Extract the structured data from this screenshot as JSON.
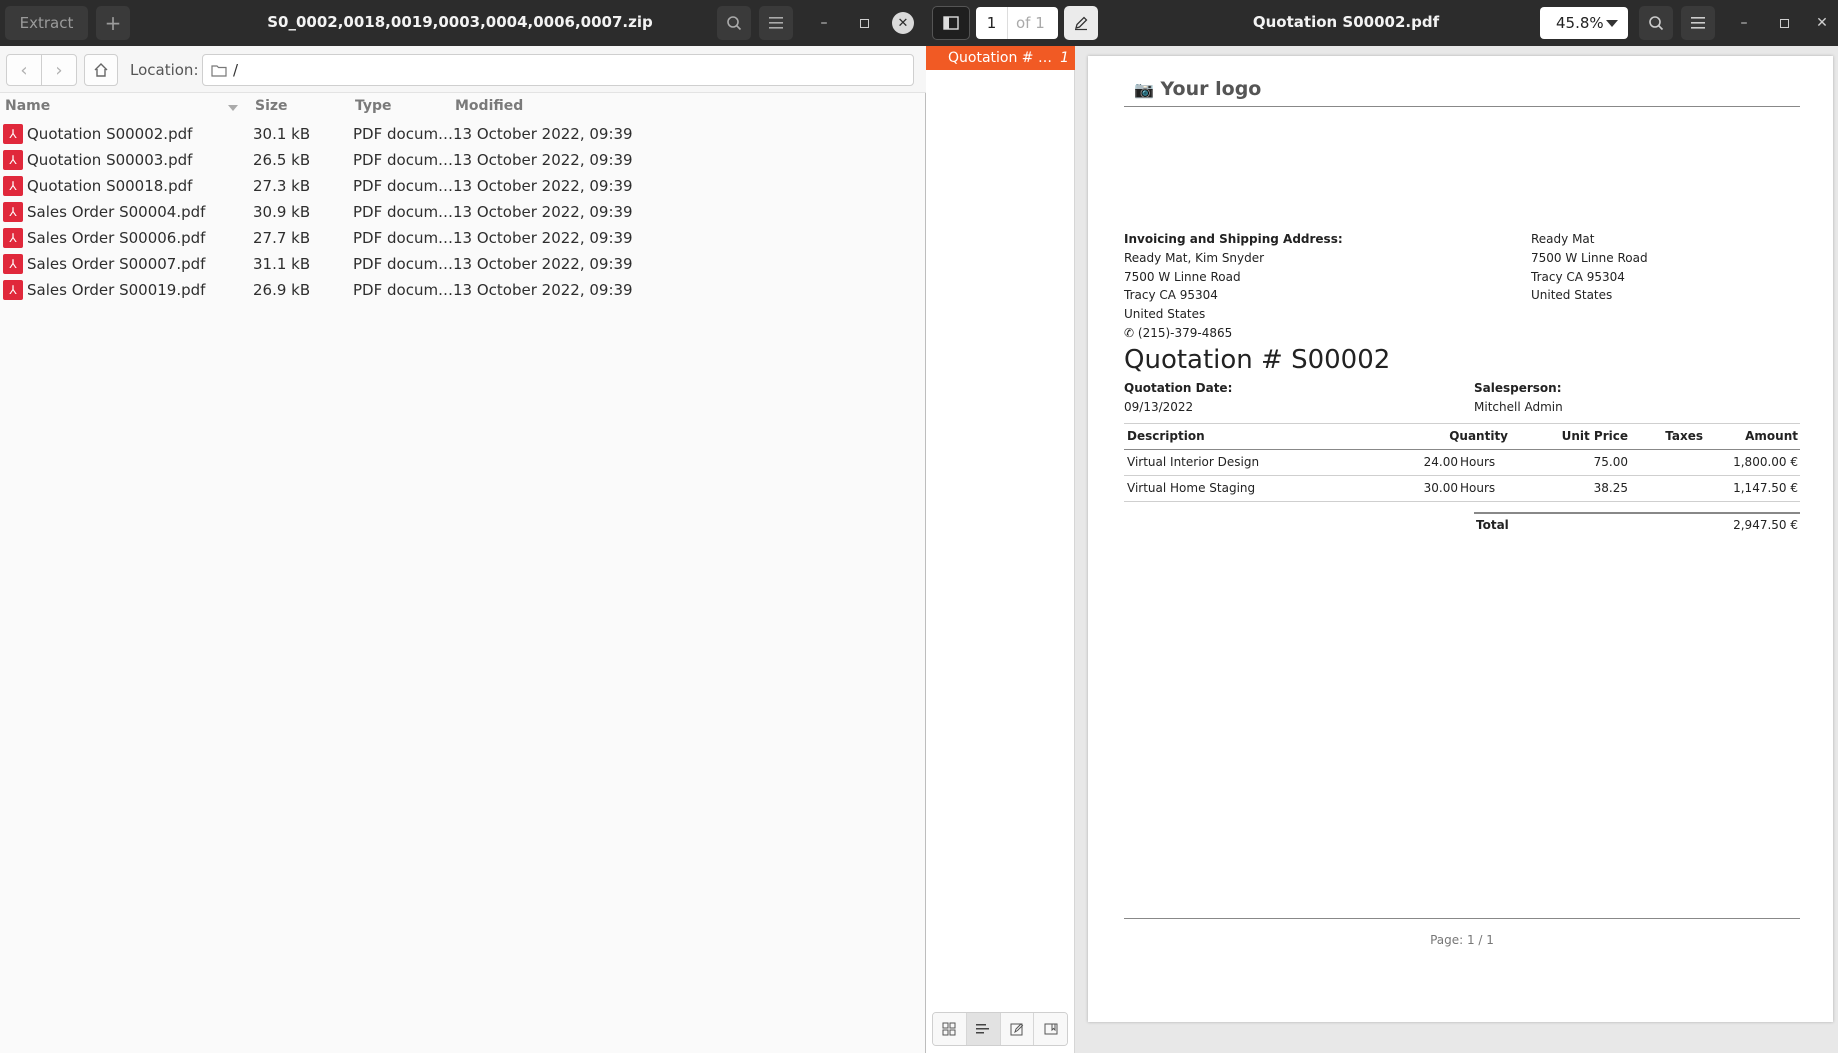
{
  "archive": {
    "extract_label": "Extract",
    "add_label": "+",
    "title": "S0_0002,0018,0019,0003,0004,0006,0007.zip",
    "location_label": "Location:",
    "location_value": "/",
    "columns": [
      "Name",
      "Size",
      "Type",
      "Modified"
    ],
    "files": [
      {
        "name": "Quotation S00002.pdf",
        "size": "30.1 kB",
        "type": "PDF docum…",
        "modified": "13 October 2022, 09:39"
      },
      {
        "name": "Quotation S00003.pdf",
        "size": "26.5 kB",
        "type": "PDF docum…",
        "modified": "13 October 2022, 09:39"
      },
      {
        "name": "Quotation S00018.pdf",
        "size": "27.3 kB",
        "type": "PDF docum…",
        "modified": "13 October 2022, 09:39"
      },
      {
        "name": "Sales Order S00004.pdf",
        "size": "30.9 kB",
        "type": "PDF docum…",
        "modified": "13 October 2022, 09:39"
      },
      {
        "name": "Sales Order S00006.pdf",
        "size": "27.7 kB",
        "type": "PDF docum…",
        "modified": "13 October 2022, 09:39"
      },
      {
        "name": "Sales Order S00007.pdf",
        "size": "31.1 kB",
        "type": "PDF docum…",
        "modified": "13 October 2022, 09:39"
      },
      {
        "name": "Sales Order S00019.pdf",
        "size": "26.9 kB",
        "type": "PDF docum…",
        "modified": "13 October 2022, 09:39"
      }
    ]
  },
  "viewer": {
    "title": "Quotation S00002.pdf",
    "page_current": "1",
    "page_of": "of 1",
    "zoom": "45.8%",
    "sidebar_item_label": "Quotation # …",
    "sidebar_item_page": "1",
    "document": {
      "logo_text": "Your logo",
      "address_heading": "Invoicing and Shipping Address:",
      "address_lines": [
        "Ready Mat, Kim Snyder",
        "7500 W Linne Road",
        "Tracy CA 95304",
        "United States"
      ],
      "phone": "(215)-379-4865",
      "company_lines": [
        "Ready Mat",
        "7500 W Linne Road",
        "Tracy CA 95304",
        "United States"
      ],
      "heading": "Quotation # S00002",
      "date_label": "Quotation Date:",
      "date_value": "09/13/2022",
      "salesperson_label": "Salesperson:",
      "salesperson_value": "Mitchell Admin",
      "table_headers": {
        "description": "Description",
        "quantity": "Quantity",
        "unit_price": "Unit Price",
        "taxes": "Taxes",
        "amount": "Amount"
      },
      "lines": [
        {
          "description": "Virtual Interior Design",
          "quantity": "24.00",
          "uom": "Hours",
          "unit_price": "75.00",
          "taxes": "",
          "amount": "1,800.00 €"
        },
        {
          "description": "Virtual Home Staging",
          "quantity": "30.00",
          "uom": "Hours",
          "unit_price": "38.25",
          "taxes": "",
          "amount": "1,147.50 €"
        }
      ],
      "total_label": "Total",
      "total_value": "2,947.50 €",
      "footer": "Page: 1 / 1"
    }
  }
}
